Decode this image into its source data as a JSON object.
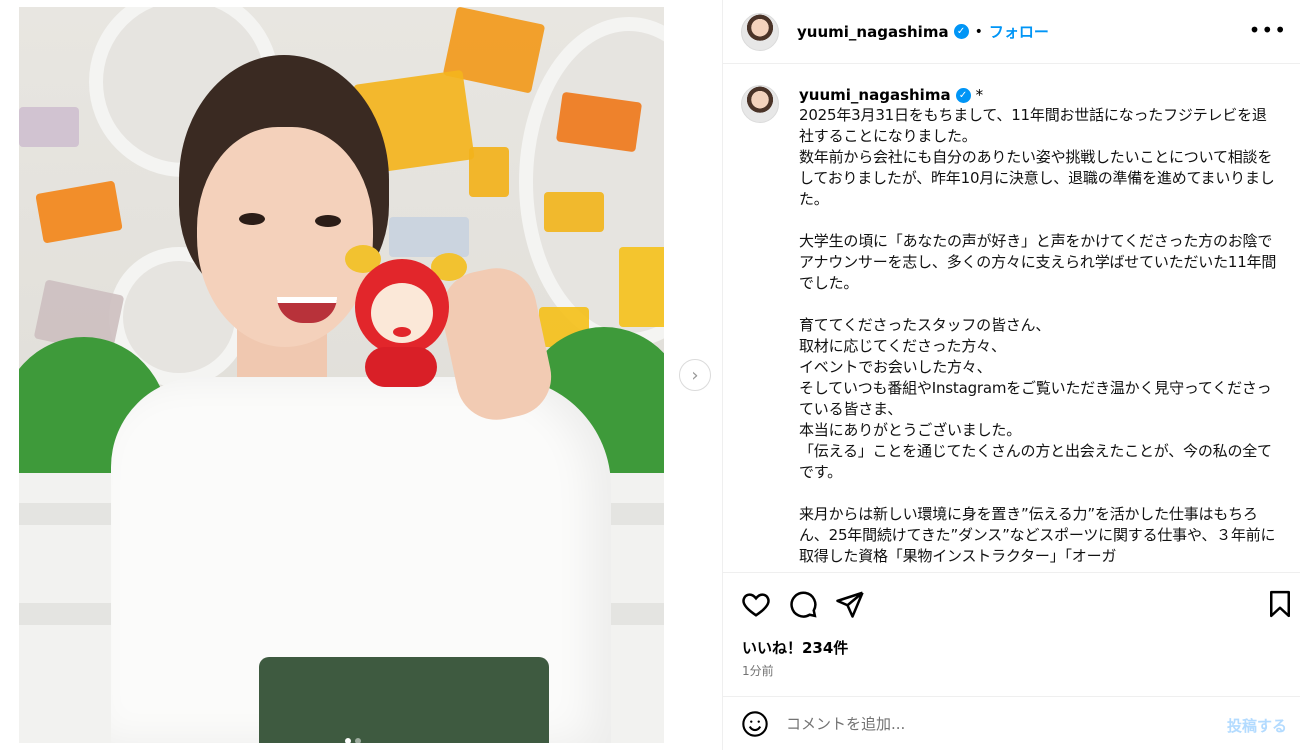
{
  "post": {
    "username": "yuumi_nagashima",
    "verified_mark": "✓",
    "separator": "•",
    "follow_label": "フォロー",
    "more_label": "•••",
    "image_next_label": "›"
  },
  "caption": {
    "username": "yuumi_nagashima",
    "edited_mark": "*",
    "text": "2025年3月31日をもちまして、11年間お世話になったフジテレビを退社することになりました。\n数年前から会社にも自分のありたい姿や挑戦したいことについて相談をしておりましたが、昨年10月に決意し、退職の準備を進めてまいりました。\n\n大学生の頃に「あなたの声が好き」と声をかけてくださった方のお陰でアナウンサーを志し、多くの方々に支えられ学ばせていただいた11年間でした。\n\n育ててくださったスタッフの皆さん、\n取材に応じてくださった方々、\nイベントでお会いした方々、\nそしていつも番組やInstagramをご覧いただき温かく見守ってくださっている皆さま、\n本当にありがとうございました。\n「伝える」ことを通じてたくさんの方と出会えたことが、今の私の全てです。\n\n来月からは新しい環境に身を置き”伝える力”を活かした仕事はもちろん、25年間続けてきた”ダンス”などスポーツに関する仕事や、３年前に取得した資格「果物インストラクター」「オーガ"
  },
  "actions": {
    "icons": [
      "heart-icon",
      "comment-icon",
      "share-icon",
      "bookmark-icon"
    ],
    "likes": "いいね！234件",
    "time": "1分前"
  },
  "comment": {
    "emoji_icon": "emoji-icon",
    "placeholder": "コメントを追加...",
    "post_label": "投稿する"
  },
  "carousel": {
    "current": 1,
    "total": 2
  },
  "colors": {
    "accent": "#0095f6",
    "post_disabled": "#b3dbff",
    "muted": "#737373"
  }
}
